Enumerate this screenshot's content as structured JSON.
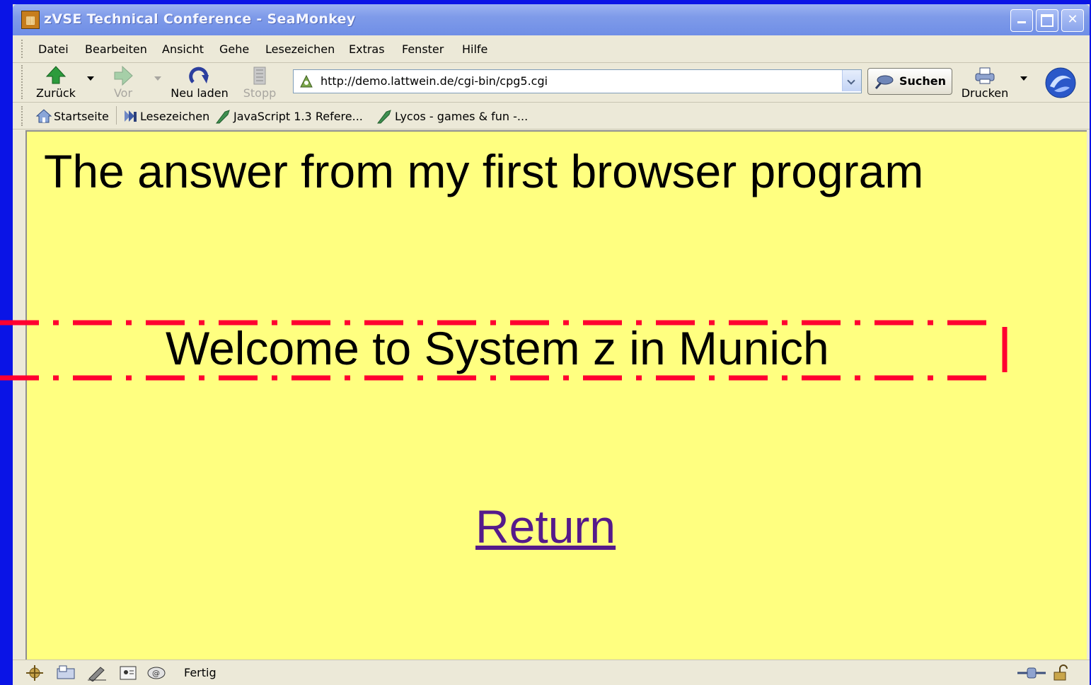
{
  "window": {
    "title": "zVSE Technical Conference - SeaMonkey",
    "minimize_icon": "minimize-icon",
    "maximize_icon": "maximize-icon",
    "close_icon": "close-icon"
  },
  "menu": {
    "items": [
      {
        "label": "Datei"
      },
      {
        "label": "Bearbeiten"
      },
      {
        "label": "Ansicht"
      },
      {
        "label": "Gehe"
      },
      {
        "label": "Lesezeichen"
      },
      {
        "label": "Extras"
      },
      {
        "label": "Fenster"
      },
      {
        "label": "Hilfe"
      }
    ]
  },
  "toolbar": {
    "back_label": "Zurück",
    "forward_label": "Vor",
    "reload_label": "Neu laden",
    "stop_label": "Stopp",
    "url": "http://demo.lattwein.de/cgi-bin/cpg5.cgi",
    "search_label": "Suchen",
    "print_label": "Drucken"
  },
  "bookmarks": {
    "home_label": "Startseite",
    "bookmarks_label": "Lesezeichen",
    "items": [
      {
        "label": "JavaScript 1.3 Refere..."
      },
      {
        "label": "Lycos - games & fun -..."
      }
    ]
  },
  "page": {
    "heading": "The answer from my first browser program",
    "welcome": "Welcome to System z in Munich",
    "return_link": "Return",
    "background": "#ffff80"
  },
  "status": {
    "text": "Fertig"
  },
  "colors": {
    "desktop": "#0a14e6",
    "annotation": "#ff0030",
    "link_visited": "#551a8b"
  }
}
